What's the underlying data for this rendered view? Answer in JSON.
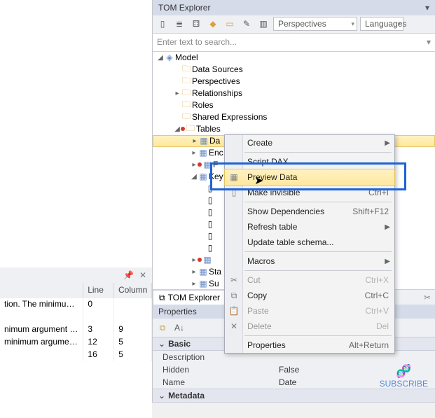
{
  "panel": {
    "title": "TOM Explorer",
    "search_placeholder": "Enter text to search...",
    "persp_label": "Perspectives",
    "lang_label": "Languages"
  },
  "tree": {
    "root": "Model",
    "folders": [
      "Data Sources",
      "Perspectives",
      "Relationships",
      "Roles",
      "Shared Expressions",
      "Tables"
    ],
    "table_nodes": [
      "Da",
      "Enc",
      "F",
      "Key",
      "",
      "",
      "",
      "",
      "",
      "",
      "Sta",
      "Su"
    ]
  },
  "tab": {
    "label": "TOM Explorer"
  },
  "props": {
    "title": "Properties",
    "cats": [
      "Basic",
      "Metadata"
    ],
    "rows": [
      {
        "k": "Description",
        "v": ""
      },
      {
        "k": "Hidden",
        "v": "False"
      },
      {
        "k": "Name",
        "v": "Date"
      }
    ]
  },
  "left_grid": {
    "cols": [
      "",
      "Line",
      "Column"
    ],
    "rows": [
      {
        "a": "tion. The minimum...",
        "b": "0",
        "c": ""
      },
      {
        "a": "",
        "b": "",
        "c": ""
      },
      {
        "a": "nimum argument c...",
        "b": "3",
        "c": "9"
      },
      {
        "a": "minimum argument c...",
        "b": "12",
        "c": "5"
      },
      {
        "a": "",
        "b": "16",
        "c": "5"
      }
    ]
  },
  "ctx": {
    "items": [
      {
        "label": "Create",
        "sub": true
      },
      {
        "label": "Script DAX"
      },
      {
        "label": "Preview Data",
        "hl": true
      },
      {
        "label": "Make invisible",
        "sc": "Ctrl+I"
      },
      {
        "label": "Show Dependencies",
        "sc": "Shift+F12"
      },
      {
        "label": "Refresh table",
        "sub": true
      },
      {
        "label": "Update table schema..."
      },
      {
        "label": "Macros",
        "sub": true
      },
      {
        "label": "Cut",
        "sc": "Ctrl+X",
        "dis": true
      },
      {
        "label": "Copy",
        "sc": "Ctrl+C"
      },
      {
        "label": "Paste",
        "sc": "Ctrl+V",
        "dis": true
      },
      {
        "label": "Delete",
        "sc": "Del",
        "dis": true
      },
      {
        "label": "Properties",
        "sc": "Alt+Return"
      }
    ]
  },
  "subscribe": "SUBSCRIBE"
}
